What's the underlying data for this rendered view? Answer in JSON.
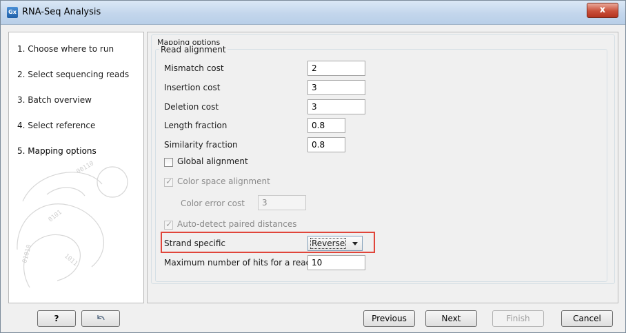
{
  "window": {
    "title": "RNA-Seq Analysis",
    "app_icon_text": "Gx",
    "close_symbol": "x"
  },
  "steps": [
    {
      "label": "1.  Choose where to run"
    },
    {
      "label": "2.  Select sequencing reads"
    },
    {
      "label": "3.  Batch overview"
    },
    {
      "label": "4.  Select reference"
    },
    {
      "label": "5.  Mapping options"
    }
  ],
  "mapping": {
    "group_title": "Mapping options",
    "read_alignment_title": "Read alignment",
    "mismatch_cost": {
      "label": "Mismatch cost",
      "value": "2"
    },
    "insertion_cost": {
      "label": "Insertion cost",
      "value": "3"
    },
    "deletion_cost": {
      "label": "Deletion cost",
      "value": "3"
    },
    "length_fraction": {
      "label": "Length fraction",
      "value": "0.8"
    },
    "similarity_fraction": {
      "label": "Similarity fraction",
      "value": "0.8"
    },
    "global_alignment": {
      "label": "Global alignment",
      "checked": false
    },
    "color_space_alignment": {
      "label": "Color space alignment",
      "checked": true,
      "disabled": true
    },
    "color_error_cost": {
      "label": "Color error cost",
      "value": "3",
      "disabled": true
    },
    "auto_detect": {
      "label": "Auto-detect paired distances",
      "checked": true,
      "disabled": true
    },
    "strand_specific": {
      "label": "Strand specific",
      "value": "Reverse"
    },
    "max_hits": {
      "label": "Maximum number of hits for a read",
      "value": "10"
    }
  },
  "footer": {
    "help_label": "?",
    "restore_icon": "undo-arrow-icon",
    "previous_label": "Previous",
    "next_label": "Next",
    "finish_label": "Finish",
    "cancel_label": "Cancel"
  },
  "colors": {
    "highlight": "#e0453a",
    "titlebar": "#c3d6ec"
  }
}
